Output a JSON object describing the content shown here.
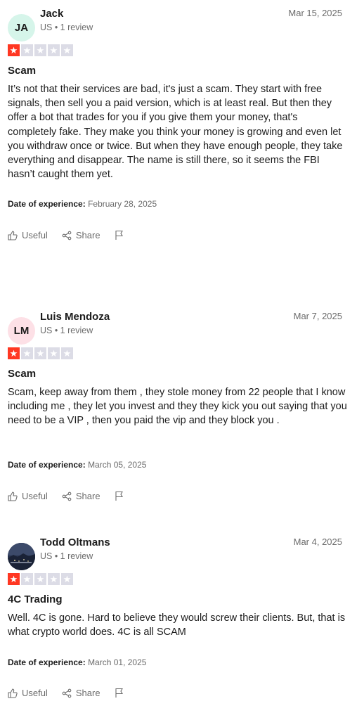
{
  "common": {
    "useful_label": "Useful",
    "share_label": "Share",
    "experience_label": "Date of experience:"
  },
  "reviews": [
    {
      "initials": "JA",
      "name": "Jack",
      "meta": "US • 1 review",
      "date": "Mar 15, 2025",
      "rating": 1,
      "title": "Scam",
      "body": "It’s not that their services are bad, it's just a scam. They start with free signals, then sell you a paid version, which is at least real. But then they offer a bot that trades for you if you give them your money, that's completely fake. They make you think your money is growing and even let you withdraw once or twice. But when they have enough people, they take everything and disappear. The name is still there, so it seems the FBI hasn’t caught them yet.",
      "experience_date": "February 28, 2025",
      "avatar_color": "#d6f5ea"
    },
    {
      "initials": "LM",
      "name": "Luis Mendoza",
      "meta": "US • 1 review",
      "date": "Mar 7, 2025",
      "rating": 1,
      "title": "Scam",
      "body": "Scam, keep away from them , they stole money from 22 people that I know including me , they let you invest and they they kick you out saying that you need to be a VIP , then you paid the vip and they block you .",
      "experience_date": "March 05, 2025",
      "avatar_color": "#fde0e6"
    },
    {
      "initials": "",
      "name": "Todd Oltmans",
      "meta": "US • 1 review",
      "date": "Mar 4, 2025",
      "rating": 1,
      "title": "4C Trading",
      "body": "Well. 4C is gone. Hard to believe they would screw their clients. But, that is what crypto world does. 4C is all SCAM",
      "experience_date": "March 01, 2025",
      "avatar_color": "#2b3550"
    }
  ],
  "colors": {
    "star_on": "#ff3722",
    "star_off": "#dcdce6",
    "muted_text": "#6b6b6b"
  },
  "icons": {
    "useful": "thumbs-up-icon",
    "share": "share-icon",
    "flag": "flag-icon",
    "star": "star-icon"
  }
}
